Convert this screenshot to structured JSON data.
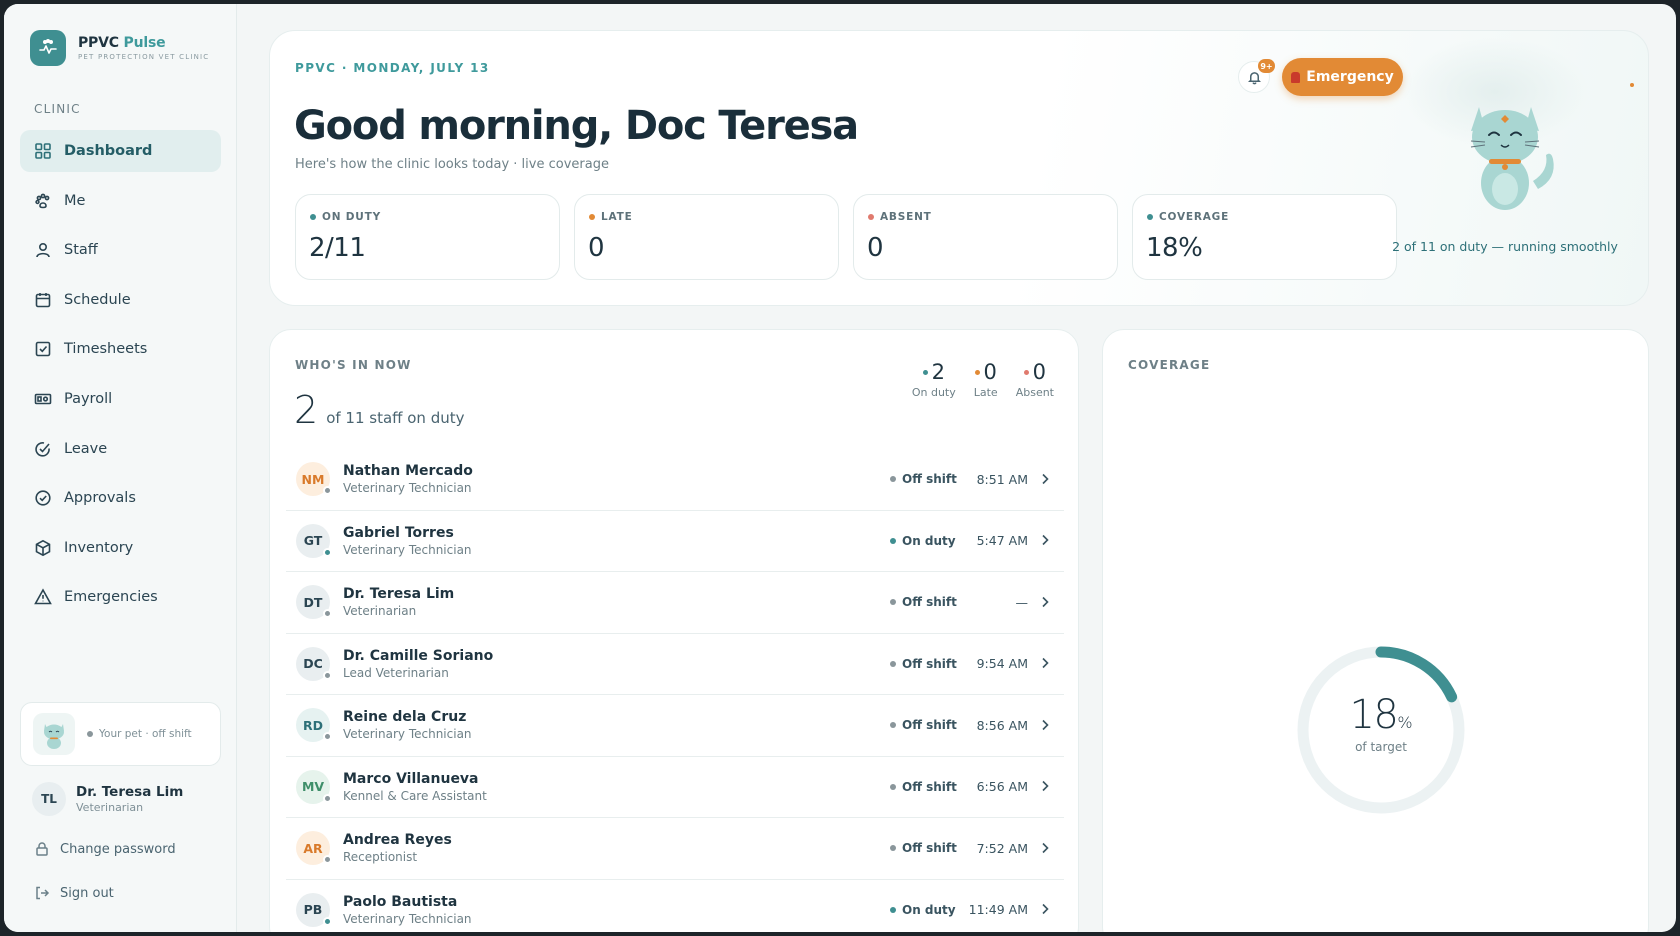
{
  "colors": {
    "accent": "#3f9a9c",
    "emergency": "#e28a35",
    "on_duty": "#3f8f91",
    "late": "#e28a35",
    "absent": "#e07a6e",
    "off_shift": "#8a969b"
  },
  "sidebar": {
    "brand_name_primary": "PPVC",
    "brand_name_accent": "Pulse",
    "brand_sub": "PET PROTECTION VET CLINIC",
    "brand_icon": "paw-pulse-icon",
    "section_label": "CLINIC",
    "nav": [
      {
        "label": "Dashboard",
        "icon": "grid-icon",
        "active": true
      },
      {
        "label": "Me",
        "icon": "paw-icon",
        "active": false
      },
      {
        "label": "Staff",
        "icon": "person-icon",
        "active": false
      },
      {
        "label": "Schedule",
        "icon": "calendar-icon",
        "active": false
      },
      {
        "label": "Timesheets",
        "icon": "checkbox-icon",
        "active": false
      },
      {
        "label": "Payroll",
        "icon": "banknote-icon",
        "active": false
      },
      {
        "label": "Leave",
        "icon": "check-arrow-icon",
        "active": false
      },
      {
        "label": "Approvals",
        "icon": "check-circle-icon",
        "active": false
      },
      {
        "label": "Inventory",
        "icon": "box-icon",
        "active": false
      },
      {
        "label": "Emergencies",
        "icon": "warning-icon",
        "active": false
      }
    ],
    "pet_status": "Your pet · off shift",
    "user": {
      "initials": "TL",
      "name": "Dr. Teresa Lim",
      "role": "Veterinarian"
    },
    "change_password": "Change password",
    "sign_out": "Sign out"
  },
  "hero": {
    "date": "PPVC · MONDAY, JULY 13",
    "title": "Good morning, Doc Teresa",
    "subtitle": "Here's how the clinic looks today · live coverage",
    "notification_badge": "9+",
    "emergency_label": "Emergency",
    "stats": [
      {
        "label": "ON DUTY",
        "value": "2/11",
        "color": "#3f8f91"
      },
      {
        "label": "LATE",
        "value": "0",
        "color": "#e28a35"
      },
      {
        "label": "ABSENT",
        "value": "0",
        "color": "#e07a6e"
      },
      {
        "label": "COVERAGE",
        "value": "18%",
        "color": "#3f8f91"
      }
    ],
    "mascot_caption": "2 of 11 on duty — running smoothly"
  },
  "who": {
    "label": "WHO'S IN NOW",
    "count": "2",
    "count_text": "of 11 staff on duty",
    "mini": [
      {
        "value": "2",
        "label": "On duty",
        "color": "#3f8f91"
      },
      {
        "value": "0",
        "label": "Late",
        "color": "#e28a35"
      },
      {
        "value": "0",
        "label": "Absent",
        "color": "#e07a6e"
      }
    ],
    "staff": [
      {
        "initials": "NM",
        "name": "Nathan Mercado",
        "role": "Veterinary Technician",
        "status": "Off shift",
        "time": "8:51 AM",
        "avatar_bg": "#fdeede",
        "avatar_fg": "#d97a2a",
        "on": false
      },
      {
        "initials": "GT",
        "name": "Gabriel Torres",
        "role": "Veterinary Technician",
        "status": "On duty",
        "time": "5:47 AM",
        "avatar_bg": "#e9eef0",
        "avatar_fg": "#2b4552",
        "on": true
      },
      {
        "initials": "DT",
        "name": "Dr. Teresa Lim",
        "role": "Veterinarian",
        "status": "Off shift",
        "time": "—",
        "avatar_bg": "#e9eef0",
        "avatar_fg": "#2b4552",
        "on": false
      },
      {
        "initials": "DC",
        "name": "Dr. Camille Soriano",
        "role": "Lead Veterinarian",
        "status": "Off shift",
        "time": "9:54 AM",
        "avatar_bg": "#e9eef0",
        "avatar_fg": "#2b4552",
        "on": false
      },
      {
        "initials": "RD",
        "name": "Reine dela Cruz",
        "role": "Veterinary Technician",
        "status": "Off shift",
        "time": "8:56 AM",
        "avatar_bg": "#e6f2f1",
        "avatar_fg": "#2d7078",
        "on": false
      },
      {
        "initials": "MV",
        "name": "Marco Villanueva",
        "role": "Kennel & Care Assistant",
        "status": "Off shift",
        "time": "6:56 AM",
        "avatar_bg": "#e6f3ec",
        "avatar_fg": "#3f8f6a",
        "on": false
      },
      {
        "initials": "AR",
        "name": "Andrea Reyes",
        "role": "Receptionist",
        "status": "Off shift",
        "time": "7:52 AM",
        "avatar_bg": "#fdeede",
        "avatar_fg": "#d97a2a",
        "on": false
      },
      {
        "initials": "PB",
        "name": "Paolo Bautista",
        "role": "Veterinary Technician",
        "status": "On duty",
        "time": "11:49 AM",
        "avatar_bg": "#e9eef0",
        "avatar_fg": "#2b4552",
        "on": true
      }
    ]
  },
  "coverage": {
    "label": "COVERAGE",
    "percent": 18,
    "percent_text": "18",
    "percent_sign": "%",
    "sub": "of target"
  }
}
